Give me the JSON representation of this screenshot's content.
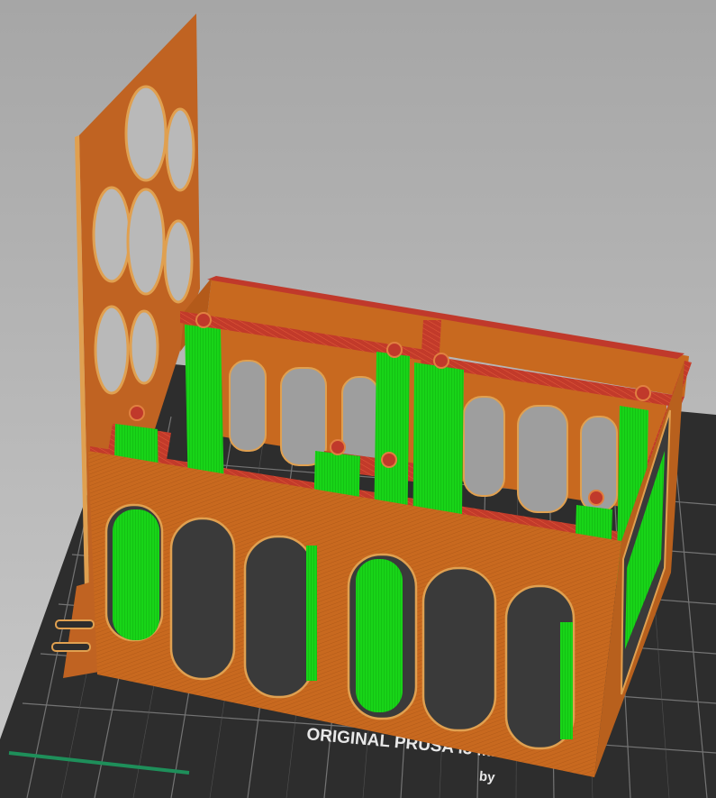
{
  "viewport": {
    "bed_label_line1": "ORIGINAL PRUSA i3 MK3",
    "bed_label_line2": "by"
  },
  "colors": {
    "background_top": "#a9a9a9",
    "background_bottom": "#c8c8c8",
    "bed": "#2b2b2b",
    "bed_grid": "#8a8a8a",
    "perimeter_orange": "#c8691f",
    "perimeter_dark": "#a4531a",
    "infill_red": "#c0392b",
    "support_green": "#17d217",
    "support_dark": "#0fa00f"
  },
  "objects": [
    {
      "name": "tall-back-panel",
      "holes": 7
    },
    {
      "name": "open-box-frame",
      "arched_windows": 6
    },
    {
      "name": "support-pillars",
      "count": 9
    }
  ]
}
